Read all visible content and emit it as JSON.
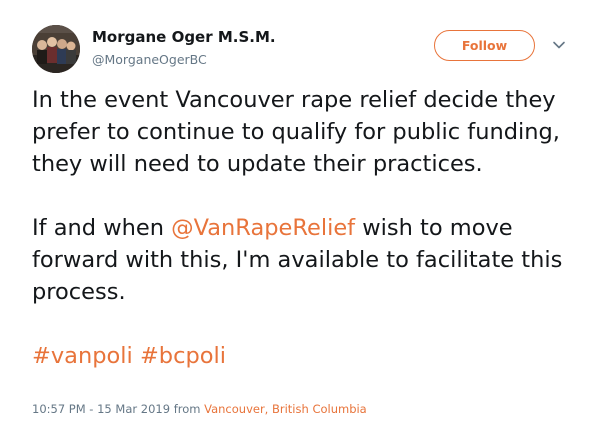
{
  "author": {
    "name": "Morgane Oger M.S.M.",
    "handle": "@MorganeOgerBC"
  },
  "follow_label": "Follow",
  "tweet": {
    "para1": "In the event Vancouver rape relief decide they prefer to continue to qualify for public funding, they will need to update their practices.",
    "para2_before": "If and when ",
    "mention": "@VanRapeRelief",
    "para2_after": " wish to move forward with this, I'm available to facilitate this process.",
    "hashtags": [
      "#vanpoli",
      "#bcpoli"
    ]
  },
  "meta": {
    "timestamp": "10:57 PM - 15 Mar 2019",
    "from_label": "from",
    "location": "Vancouver, British Columbia"
  },
  "colors": {
    "accent": "#e8743b",
    "text": "#14171a",
    "muted": "#657786"
  }
}
